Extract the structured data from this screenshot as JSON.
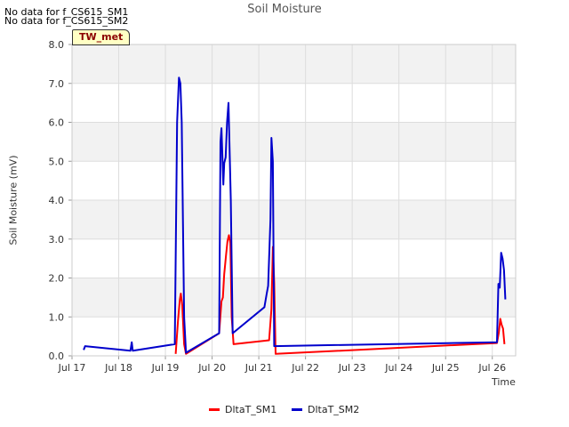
{
  "no_data_messages": [
    "No data for f_CS615_SM1",
    "No data for f_CS615_SM2"
  ],
  "site_badge": "TW_met",
  "chart_data": {
    "type": "line",
    "title": "Soil Moisture",
    "xlabel": "Time",
    "ylabel": "Soil Moisture (mV)",
    "xlim": [
      17.0,
      26.5
    ],
    "ylim": [
      0,
      8
    ],
    "x_ticks": [
      {
        "value": 17,
        "label": "Jul 17"
      },
      {
        "value": 18,
        "label": "Jul 18"
      },
      {
        "value": 19,
        "label": "Jul 19"
      },
      {
        "value": 20,
        "label": "Jul 20"
      },
      {
        "value": 21,
        "label": "Jul 21"
      },
      {
        "value": 22,
        "label": "Jul 22"
      },
      {
        "value": 23,
        "label": "Jul 23"
      },
      {
        "value": 24,
        "label": "Jul 24"
      },
      {
        "value": 25,
        "label": "Jul 25"
      },
      {
        "value": 26,
        "label": "Jul 26"
      }
    ],
    "y_ticks": [
      "0.0",
      "1.0",
      "2.0",
      "3.0",
      "4.0",
      "5.0",
      "6.0",
      "7.0",
      "8.0"
    ],
    "grid": true,
    "legend_position": "bottom",
    "series": [
      {
        "name": "DltaT_SM1",
        "color": "#ff0000",
        "points": [
          [
            19.22,
            0.05
          ],
          [
            19.27,
            0.9
          ],
          [
            19.31,
            1.45
          ],
          [
            19.33,
            1.6
          ],
          [
            19.36,
            1.3
          ],
          [
            19.4,
            0.3
          ],
          [
            19.44,
            0.05
          ],
          [
            20.15,
            0.58
          ],
          [
            20.2,
            1.4
          ],
          [
            20.23,
            1.5
          ],
          [
            20.26,
            2.1
          ],
          [
            20.3,
            2.6
          ],
          [
            20.33,
            2.95
          ],
          [
            20.36,
            3.1
          ],
          [
            20.39,
            2.9
          ],
          [
            20.42,
            1.0
          ],
          [
            20.46,
            0.3
          ],
          [
            21.22,
            0.4
          ],
          [
            21.27,
            1.2
          ],
          [
            21.3,
            2.8
          ],
          [
            21.33,
            1.9
          ],
          [
            21.36,
            0.05
          ],
          [
            26.1,
            0.33
          ],
          [
            26.14,
            0.6
          ],
          [
            26.17,
            0.95
          ],
          [
            26.2,
            0.8
          ],
          [
            26.23,
            0.7
          ],
          [
            26.26,
            0.3
          ]
        ]
      },
      {
        "name": "DltaT_SM2",
        "color": "#0000cc",
        "points": [
          [
            17.25,
            0.15
          ],
          [
            17.28,
            0.25
          ],
          [
            18.25,
            0.13
          ],
          [
            18.28,
            0.35
          ],
          [
            18.3,
            0.13
          ],
          [
            19.2,
            0.3
          ],
          [
            19.25,
            6.0
          ],
          [
            19.29,
            7.15
          ],
          [
            19.32,
            7.0
          ],
          [
            19.35,
            6.0
          ],
          [
            19.4,
            1.0
          ],
          [
            19.44,
            0.08
          ],
          [
            20.15,
            0.58
          ],
          [
            20.18,
            5.5
          ],
          [
            20.2,
            5.85
          ],
          [
            20.24,
            4.4
          ],
          [
            20.26,
            4.95
          ],
          [
            20.29,
            5.1
          ],
          [
            20.32,
            6.0
          ],
          [
            20.35,
            6.5
          ],
          [
            20.4,
            4.0
          ],
          [
            20.44,
            0.58
          ],
          [
            21.12,
            1.25
          ],
          [
            21.17,
            1.6
          ],
          [
            21.2,
            1.8
          ],
          [
            21.25,
            3.5
          ],
          [
            21.27,
            5.6
          ],
          [
            21.3,
            5.0
          ],
          [
            21.33,
            0.25
          ],
          [
            26.1,
            0.35
          ],
          [
            26.13,
            1.85
          ],
          [
            26.16,
            1.75
          ],
          [
            26.19,
            2.65
          ],
          [
            26.22,
            2.5
          ],
          [
            26.25,
            2.2
          ],
          [
            26.28,
            1.45
          ]
        ]
      }
    ]
  }
}
